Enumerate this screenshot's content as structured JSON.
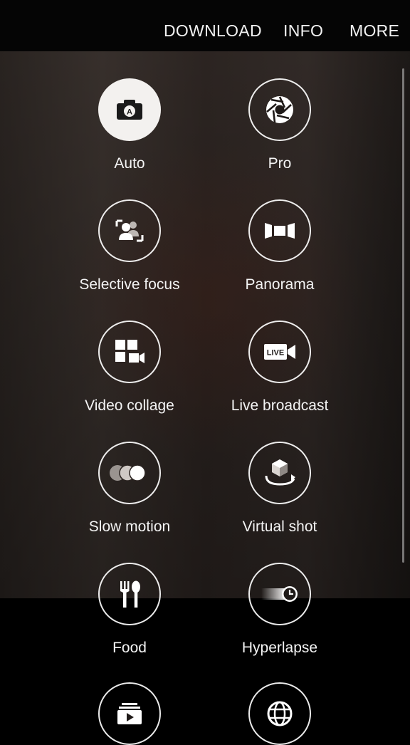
{
  "top_bar": {
    "download": "DOWNLOAD",
    "info": "INFO",
    "more": "MORE"
  },
  "modes": [
    {
      "label": "Auto",
      "icon": "camera-auto-icon",
      "selected": true
    },
    {
      "label": "Pro",
      "icon": "aperture-icon"
    },
    {
      "label": "Selective focus",
      "icon": "selective-focus-icon"
    },
    {
      "label": "Panorama",
      "icon": "panorama-icon"
    },
    {
      "label": "Video collage",
      "icon": "video-collage-icon"
    },
    {
      "label": "Live broadcast",
      "icon": "live-broadcast-icon",
      "badge": "LIVE"
    },
    {
      "label": "Slow motion",
      "icon": "slow-motion-icon"
    },
    {
      "label": "Virtual shot",
      "icon": "virtual-shot-icon"
    },
    {
      "label": "Food",
      "icon": "food-icon"
    },
    {
      "label": "Hyperlapse",
      "icon": "hyperlapse-icon"
    },
    {
      "label": "",
      "icon": "video-play-icon"
    },
    {
      "label": "",
      "icon": "globe-icon"
    }
  ],
  "colors": {
    "topbar": "#050505",
    "selected_circle": "#f3f1ef",
    "text": "#f4f4f4"
  }
}
